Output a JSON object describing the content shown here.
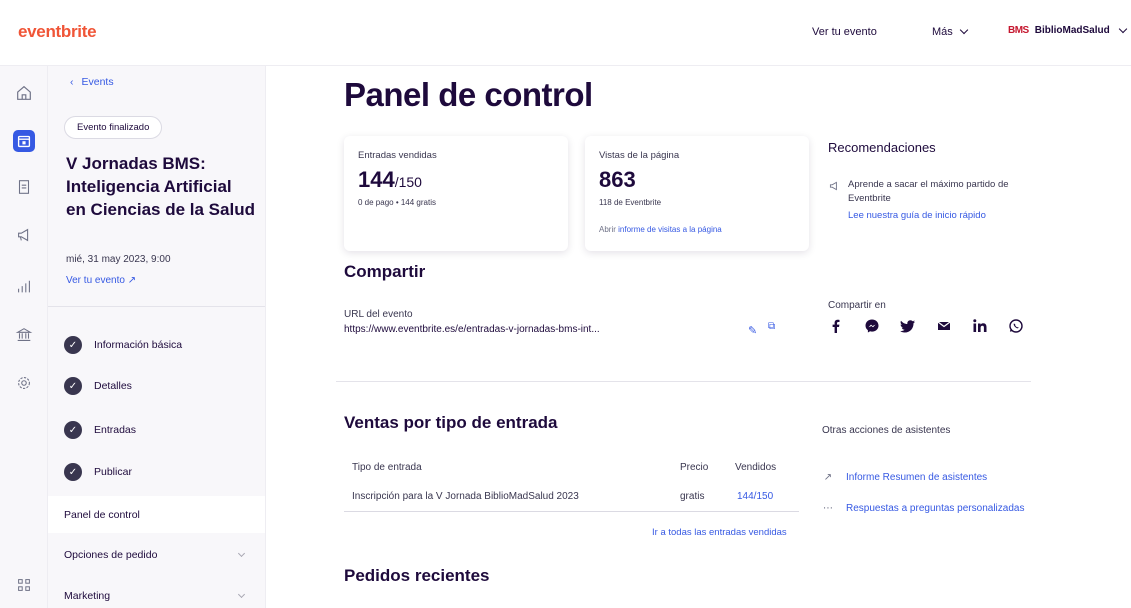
{
  "topbar": {
    "logo": "eventbrite",
    "view_event": "Ver tu evento",
    "more": "Más",
    "org_logo": "BMS",
    "org_name": "BiblioMadSalud"
  },
  "sidebar": {
    "back": "Events",
    "status_badge": "Evento finalizado",
    "event_title": "V Jornadas BMS: Inteligencia Artificial en Ciencias de la Salud",
    "event_date": "mié, 31 may 2023, 9:00",
    "view_event_link": "Ver tu evento",
    "steps": [
      {
        "label": "Información básica"
      },
      {
        "label": "Detalles"
      },
      {
        "label": "Entradas"
      },
      {
        "label": "Publicar"
      }
    ],
    "active_item": "Panel de control",
    "items": [
      {
        "label": "Opciones de pedido"
      },
      {
        "label": "Marketing"
      }
    ]
  },
  "main": {
    "title": "Panel de control",
    "tickets_card": {
      "label": "Entradas vendidas",
      "sold": "144",
      "total": "/150",
      "sub": "0 de pago • 144 gratis"
    },
    "views_card": {
      "label": "Vistas de la página",
      "value": "863",
      "sub": "118 de Eventbrite",
      "link_prefix": "Abrir",
      "link_text": "informe de visitas a la página"
    },
    "recommendations": {
      "title": "Recomendaciones",
      "text": "Aprende a sacar el máximo partido de Eventbrite",
      "link": "Lee nuestra guía de inicio rápido"
    },
    "share": {
      "title": "Compartir",
      "url_label": "URL del evento",
      "url_value": "https://www.eventbrite.es/e/entradas-v-jornadas-bms-int...",
      "share_on": "Compartir en"
    },
    "sales": {
      "title": "Ventas por tipo de entrada",
      "headers": [
        "Tipo de entrada",
        "Precio",
        "Vendidos"
      ],
      "rows": [
        {
          "type": "Inscripción para la V Jornada BiblioMadSalud 2023",
          "price": "gratis",
          "sold": "144/150"
        }
      ],
      "all_link": "Ir a todas las entradas vendidas"
    },
    "attendee_actions": {
      "title": "Otras acciones de asistentes",
      "items": [
        {
          "label": "Informe Resumen de asistentes"
        },
        {
          "label": "Respuestas a preguntas personalizadas"
        }
      ]
    },
    "recent_orders_title": "Pedidos recientes"
  },
  "colors": {
    "brand": "#f05537",
    "accent": "#3659e3",
    "text": "#1e0a3c"
  }
}
